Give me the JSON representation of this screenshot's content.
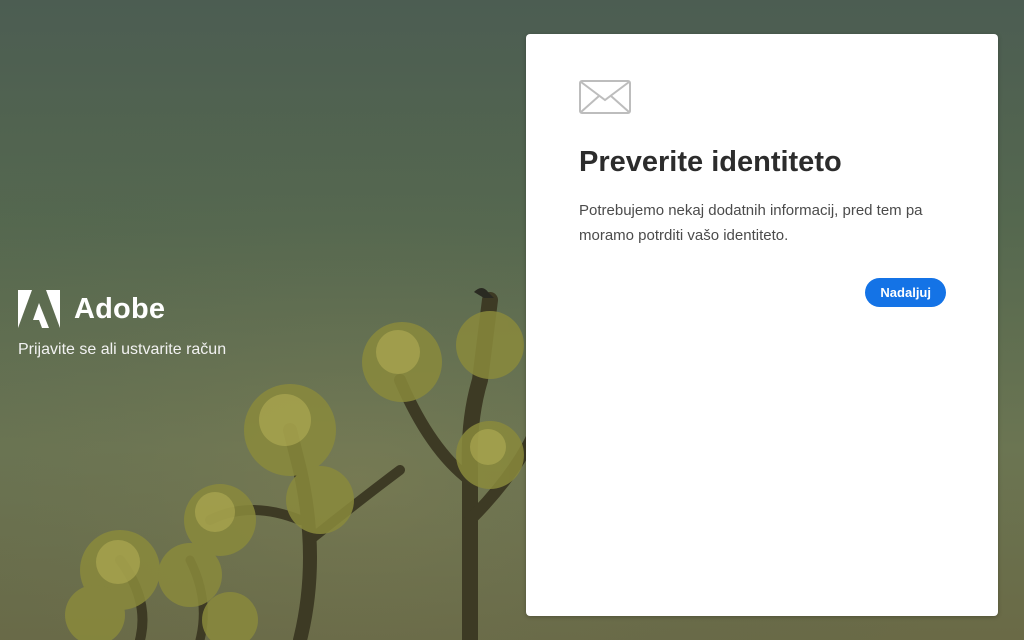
{
  "brand": {
    "name": "Adobe",
    "tagline": "Prijavite se ali ustvarite račun",
    "logo_icon": "adobe-logo-icon"
  },
  "card": {
    "icon": "envelope-icon",
    "title": "Preverite identiteto",
    "message": "Potrebujemo nekaj dodatnih informacij, pred tem pa moramo potrditi vašo identiteto.",
    "continue_label": "Nadaljuj"
  },
  "colors": {
    "accent": "#1473e6",
    "card_bg": "#ffffff",
    "title_text": "#2c2c2c",
    "body_text": "#4b4b4b",
    "brand_text": "#ffffff"
  }
}
